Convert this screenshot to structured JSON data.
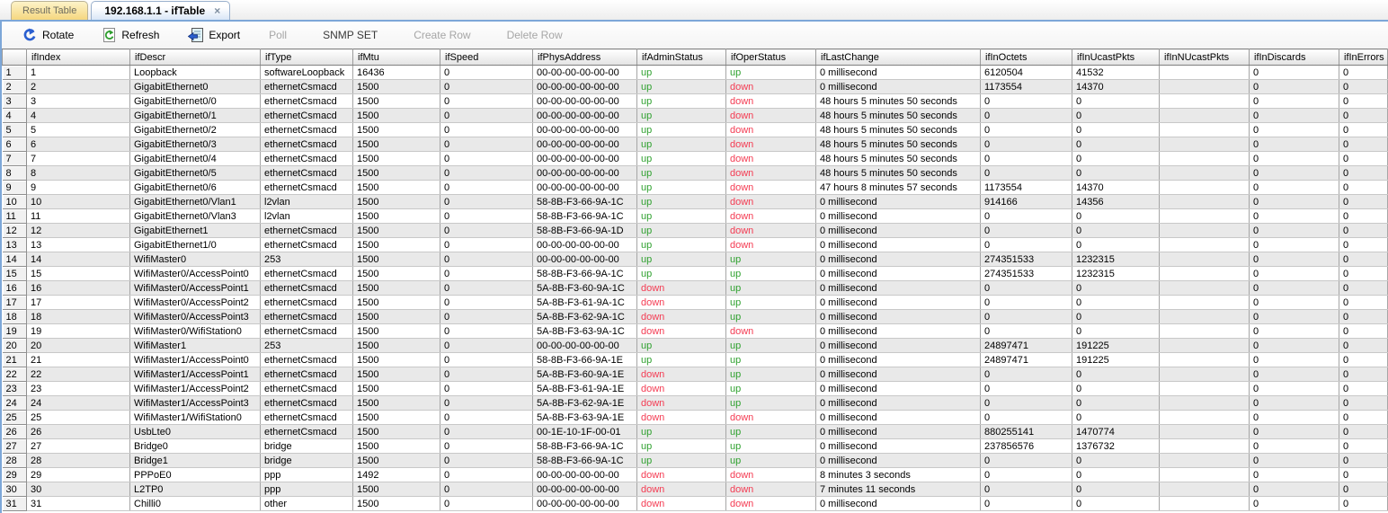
{
  "tabs": [
    {
      "label": "Result Table",
      "active": false
    },
    {
      "label": "192.168.1.1 - ifTable",
      "active": true,
      "close_glyph": "×"
    }
  ],
  "toolbar": {
    "buttons": [
      {
        "label": "Rotate",
        "icon": "rotate-icon",
        "enabled": true
      },
      {
        "label": "Refresh",
        "icon": "refresh-icon",
        "enabled": true
      },
      {
        "label": "Export",
        "icon": "export-icon",
        "enabled": true
      },
      {
        "label": "Poll",
        "icon": null,
        "enabled": false
      },
      {
        "label": "SNMP SET",
        "icon": null,
        "enabled": true
      },
      {
        "label": "Create Row",
        "icon": null,
        "enabled": false
      },
      {
        "label": "Delete Row",
        "icon": null,
        "enabled": false
      }
    ]
  },
  "colors": {
    "panel_border_blue": "#7da7d8",
    "inactive_tab_yellow": "#f5d77f",
    "status_up": "#2fa12f",
    "status_down": "#f43b52",
    "row_alt": "#e9e9e9"
  },
  "table": {
    "columns": [
      {
        "key": "rownum",
        "label": ""
      },
      {
        "key": "ifIndex",
        "label": "ifIndex"
      },
      {
        "key": "ifDescr",
        "label": "ifDescr"
      },
      {
        "key": "ifType",
        "label": "ifType"
      },
      {
        "key": "ifMtu",
        "label": "ifMtu"
      },
      {
        "key": "ifSpeed",
        "label": "ifSpeed"
      },
      {
        "key": "ifPhysAddress",
        "label": "ifPhysAddress"
      },
      {
        "key": "ifAdminStatus",
        "label": "ifAdminStatus"
      },
      {
        "key": "ifOperStatus",
        "label": "ifOperStatus"
      },
      {
        "key": "ifLastChange",
        "label": "ifLastChange"
      },
      {
        "key": "ifInOctets",
        "label": "ifInOctets"
      },
      {
        "key": "ifInUcastPkts",
        "label": "ifInUcastPkts"
      },
      {
        "key": "ifInNUcastPkts",
        "label": "ifInNUcastPkts"
      },
      {
        "key": "ifInDiscards",
        "label": "ifInDiscards"
      },
      {
        "key": "ifInErrors",
        "label": "ifInErrors"
      }
    ],
    "status_column_indexes": [
      7,
      8
    ],
    "rows": [
      [
        "1",
        "1",
        "Loopback",
        "softwareLoopback",
        "16436",
        "0",
        "00-00-00-00-00-00",
        "up",
        "up",
        "0 millisecond",
        "6120504",
        "41532",
        "",
        "0",
        "0"
      ],
      [
        "2",
        "2",
        "GigabitEthernet0",
        "ethernetCsmacd",
        "1500",
        "0",
        "00-00-00-00-00-00",
        "up",
        "down",
        "0 millisecond",
        "1173554",
        "14370",
        "",
        "0",
        "0"
      ],
      [
        "3",
        "3",
        "GigabitEthernet0/0",
        "ethernetCsmacd",
        "1500",
        "0",
        "00-00-00-00-00-00",
        "up",
        "down",
        "48 hours 5 minutes 50 seconds",
        "0",
        "0",
        "",
        "0",
        "0"
      ],
      [
        "4",
        "4",
        "GigabitEthernet0/1",
        "ethernetCsmacd",
        "1500",
        "0",
        "00-00-00-00-00-00",
        "up",
        "down",
        "48 hours 5 minutes 50 seconds",
        "0",
        "0",
        "",
        "0",
        "0"
      ],
      [
        "5",
        "5",
        "GigabitEthernet0/2",
        "ethernetCsmacd",
        "1500",
        "0",
        "00-00-00-00-00-00",
        "up",
        "down",
        "48 hours 5 minutes 50 seconds",
        "0",
        "0",
        "",
        "0",
        "0"
      ],
      [
        "6",
        "6",
        "GigabitEthernet0/3",
        "ethernetCsmacd",
        "1500",
        "0",
        "00-00-00-00-00-00",
        "up",
        "down",
        "48 hours 5 minutes 50 seconds",
        "0",
        "0",
        "",
        "0",
        "0"
      ],
      [
        "7",
        "7",
        "GigabitEthernet0/4",
        "ethernetCsmacd",
        "1500",
        "0",
        "00-00-00-00-00-00",
        "up",
        "down",
        "48 hours 5 minutes 50 seconds",
        "0",
        "0",
        "",
        "0",
        "0"
      ],
      [
        "8",
        "8",
        "GigabitEthernet0/5",
        "ethernetCsmacd",
        "1500",
        "0",
        "00-00-00-00-00-00",
        "up",
        "down",
        "48 hours 5 minutes 50 seconds",
        "0",
        "0",
        "",
        "0",
        "0"
      ],
      [
        "9",
        "9",
        "GigabitEthernet0/6",
        "ethernetCsmacd",
        "1500",
        "0",
        "00-00-00-00-00-00",
        "up",
        "down",
        "47 hours 8 minutes 57 seconds",
        "1173554",
        "14370",
        "",
        "0",
        "0"
      ],
      [
        "10",
        "10",
        "GigabitEthernet0/Vlan1",
        "l2vlan",
        "1500",
        "0",
        "58-8B-F3-66-9A-1C",
        "up",
        "down",
        "0 millisecond",
        "914166",
        "14356",
        "",
        "0",
        "0"
      ],
      [
        "11",
        "11",
        "GigabitEthernet0/Vlan3",
        "l2vlan",
        "1500",
        "0",
        "58-8B-F3-66-9A-1C",
        "up",
        "down",
        "0 millisecond",
        "0",
        "0",
        "",
        "0",
        "0"
      ],
      [
        "12",
        "12",
        "GigabitEthernet1",
        "ethernetCsmacd",
        "1500",
        "0",
        "58-8B-F3-66-9A-1D",
        "up",
        "down",
        "0 millisecond",
        "0",
        "0",
        "",
        "0",
        "0"
      ],
      [
        "13",
        "13",
        "GigabitEthernet1/0",
        "ethernetCsmacd",
        "1500",
        "0",
        "00-00-00-00-00-00",
        "up",
        "down",
        "0 millisecond",
        "0",
        "0",
        "",
        "0",
        "0"
      ],
      [
        "14",
        "14",
        "WifiMaster0",
        "253",
        "1500",
        "0",
        "00-00-00-00-00-00",
        "up",
        "up",
        "0 millisecond",
        "274351533",
        "1232315",
        "",
        "0",
        "0"
      ],
      [
        "15",
        "15",
        "WifiMaster0/AccessPoint0",
        "ethernetCsmacd",
        "1500",
        "0",
        "58-8B-F3-66-9A-1C",
        "up",
        "up",
        "0 millisecond",
        "274351533",
        "1232315",
        "",
        "0",
        "0"
      ],
      [
        "16",
        "16",
        "WifiMaster0/AccessPoint1",
        "ethernetCsmacd",
        "1500",
        "0",
        "5A-8B-F3-60-9A-1C",
        "down",
        "up",
        "0 millisecond",
        "0",
        "0",
        "",
        "0",
        "0"
      ],
      [
        "17",
        "17",
        "WifiMaster0/AccessPoint2",
        "ethernetCsmacd",
        "1500",
        "0",
        "5A-8B-F3-61-9A-1C",
        "down",
        "up",
        "0 millisecond",
        "0",
        "0",
        "",
        "0",
        "0"
      ],
      [
        "18",
        "18",
        "WifiMaster0/AccessPoint3",
        "ethernetCsmacd",
        "1500",
        "0",
        "5A-8B-F3-62-9A-1C",
        "down",
        "up",
        "0 millisecond",
        "0",
        "0",
        "",
        "0",
        "0"
      ],
      [
        "19",
        "19",
        "WifiMaster0/WifiStation0",
        "ethernetCsmacd",
        "1500",
        "0",
        "5A-8B-F3-63-9A-1C",
        "down",
        "down",
        "0 millisecond",
        "0",
        "0",
        "",
        "0",
        "0"
      ],
      [
        "20",
        "20",
        "WifiMaster1",
        "253",
        "1500",
        "0",
        "00-00-00-00-00-00",
        "up",
        "up",
        "0 millisecond",
        "24897471",
        "191225",
        "",
        "0",
        "0"
      ],
      [
        "21",
        "21",
        "WifiMaster1/AccessPoint0",
        "ethernetCsmacd",
        "1500",
        "0",
        "58-8B-F3-66-9A-1E",
        "up",
        "up",
        "0 millisecond",
        "24897471",
        "191225",
        "",
        "0",
        "0"
      ],
      [
        "22",
        "22",
        "WifiMaster1/AccessPoint1",
        "ethernetCsmacd",
        "1500",
        "0",
        "5A-8B-F3-60-9A-1E",
        "down",
        "up",
        "0 millisecond",
        "0",
        "0",
        "",
        "0",
        "0"
      ],
      [
        "23",
        "23",
        "WifiMaster1/AccessPoint2",
        "ethernetCsmacd",
        "1500",
        "0",
        "5A-8B-F3-61-9A-1E",
        "down",
        "up",
        "0 millisecond",
        "0",
        "0",
        "",
        "0",
        "0"
      ],
      [
        "24",
        "24",
        "WifiMaster1/AccessPoint3",
        "ethernetCsmacd",
        "1500",
        "0",
        "5A-8B-F3-62-9A-1E",
        "down",
        "up",
        "0 millisecond",
        "0",
        "0",
        "",
        "0",
        "0"
      ],
      [
        "25",
        "25",
        "WifiMaster1/WifiStation0",
        "ethernetCsmacd",
        "1500",
        "0",
        "5A-8B-F3-63-9A-1E",
        "down",
        "down",
        "0 millisecond",
        "0",
        "0",
        "",
        "0",
        "0"
      ],
      [
        "26",
        "26",
        "UsbLte0",
        "ethernetCsmacd",
        "1500",
        "0",
        "00-1E-10-1F-00-01",
        "up",
        "up",
        "0 millisecond",
        "880255141",
        "1470774",
        "",
        "0",
        "0"
      ],
      [
        "27",
        "27",
        "Bridge0",
        "bridge",
        "1500",
        "0",
        "58-8B-F3-66-9A-1C",
        "up",
        "up",
        "0 millisecond",
        "237856576",
        "1376732",
        "",
        "0",
        "0"
      ],
      [
        "28",
        "28",
        "Bridge1",
        "bridge",
        "1500",
        "0",
        "58-8B-F3-66-9A-1C",
        "up",
        "up",
        "0 millisecond",
        "0",
        "0",
        "",
        "0",
        "0"
      ],
      [
        "29",
        "29",
        "PPPoE0",
        "ppp",
        "1492",
        "0",
        "00-00-00-00-00-00",
        "down",
        "down",
        "8 minutes 3 seconds",
        "0",
        "0",
        "",
        "0",
        "0"
      ],
      [
        "30",
        "30",
        "L2TP0",
        "ppp",
        "1500",
        "0",
        "00-00-00-00-00-00",
        "down",
        "down",
        "7 minutes 11 seconds",
        "0",
        "0",
        "",
        "0",
        "0"
      ],
      [
        "31",
        "31",
        "Chilli0",
        "other",
        "1500",
        "0",
        "00-00-00-00-00-00",
        "down",
        "down",
        "0 millisecond",
        "0",
        "0",
        "",
        "0",
        "0"
      ]
    ]
  }
}
